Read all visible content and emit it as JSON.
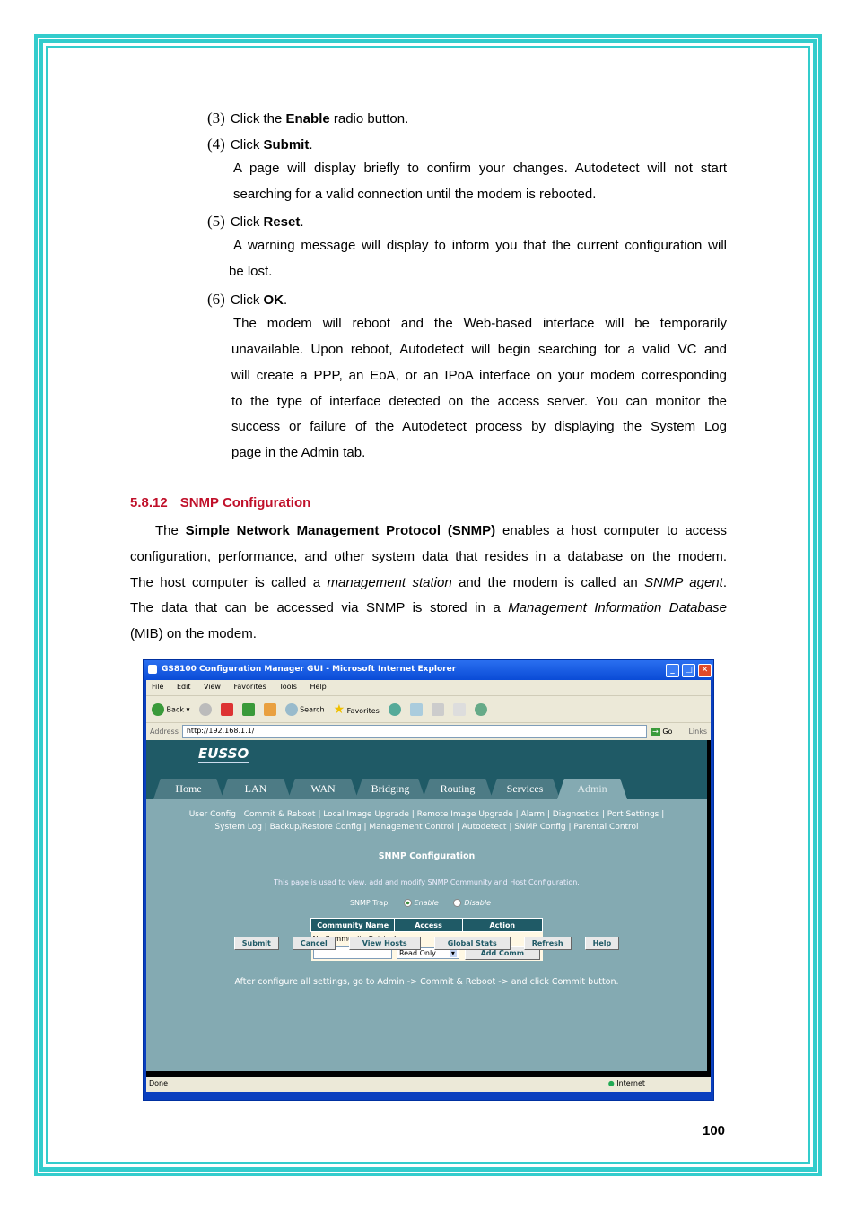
{
  "steps": [
    {
      "num": "(3)",
      "pre": "Click the ",
      "bold": "Enable",
      "post": " radio button."
    },
    {
      "num": "(4)",
      "pre": "Click ",
      "bold": "Submit",
      "post": "."
    },
    {
      "num": "(5)",
      "pre": "Click ",
      "bold": "Reset",
      "post": "."
    },
    {
      "num": "(6)",
      "pre": "Click ",
      "bold": "OK",
      "post": "."
    }
  ],
  "step4_lines": [
    "A page will display briefly to confirm your changes. Autodetect will not start",
    "searching for a valid connection until the modem is rebooted."
  ],
  "step5_lines": [
    "A warning message will display to inform you that the current configuration will",
    "be lost."
  ],
  "step6_lines": [
    "The modem will reboot and the Web-based interface will be temporarily",
    "unavailable. Upon reboot, Autodetect will begin searching for a valid VC and",
    "will create a PPP, an EoA, or an IPoA interface on your modem corresponding",
    "to the type of interface detected on the access server. You can monitor the",
    "success or failure of the Autodetect process by displaying the System Log",
    "page in the Admin tab."
  ],
  "section": {
    "number": "5.8.12",
    "title": "SNMP Configuration"
  },
  "intro": {
    "l1_pre": "The ",
    "l1_bold": "Simple Network Management Protocol (SNMP)",
    "l1_post": " enables a host computer to access",
    "l2": "configuration, performance, and other system data that resides in a database on the modem.",
    "l3_pre": "The host computer is called a ",
    "l3_it1": "management station",
    "l3_mid": " and the modem is called an ",
    "l3_it2": "SNMP agent",
    "l3_post": ".",
    "l4_pre": "The data that can be accessed via SNMP is stored in a ",
    "l4_it": "Management Information Database",
    "l5": "(MIB) on the modem."
  },
  "browser": {
    "title": "GS8100 Configuration Manager GUI - Microsoft Internet Explorer",
    "menu": [
      "File",
      "Edit",
      "View",
      "Favorites",
      "Tools",
      "Help"
    ],
    "toolbar": {
      "back": "Back",
      "search": "Search",
      "favorites": "Favorites"
    },
    "address_label": "Address",
    "address": "http://192.168.1.1/",
    "go": "Go",
    "links": "Links",
    "status": "Done",
    "zone": "Internet"
  },
  "router": {
    "logo": "EUSSO",
    "tabs": [
      "Home",
      "LAN",
      "WAN",
      "Bridging",
      "Routing",
      "Services",
      "Admin"
    ],
    "active_tab": "Admin",
    "links_row1": "User Config | Commit & Reboot | Local Image Upgrade | Remote Image Upgrade | Alarm | Diagnostics | Port Settings |",
    "links_row2": "System Log | Backup/Restore Config | Management Control | Autodetect | SNMP Config | Parental Control",
    "page_title": "SNMP Configuration",
    "description": "This page is used to view, add and modify SNMP Community and Host Configuration.",
    "trap_label": "SNMP Trap:",
    "trap_enable": "Enable",
    "trap_disable": "Disable",
    "trap_selected": "Enable",
    "table_headers": [
      "Community Name",
      "Access",
      "Action"
    ],
    "empty_row": "No Community Entries!",
    "community_input": "",
    "access_select": "Read Only",
    "add_button": "Add Comm",
    "buttons": [
      "Submit",
      "Cancel",
      "View Hosts",
      "Global Stats",
      "Refresh",
      "Help"
    ],
    "note": "After configure all settings, go to Admin -> Commit & Reboot -> and click Commit button."
  },
  "page_number": "100",
  "colors": {
    "border": "#33cccc",
    "heading": "#c0102a",
    "router_dark": "#1f5a66",
    "router_bg": "#84aab2"
  }
}
